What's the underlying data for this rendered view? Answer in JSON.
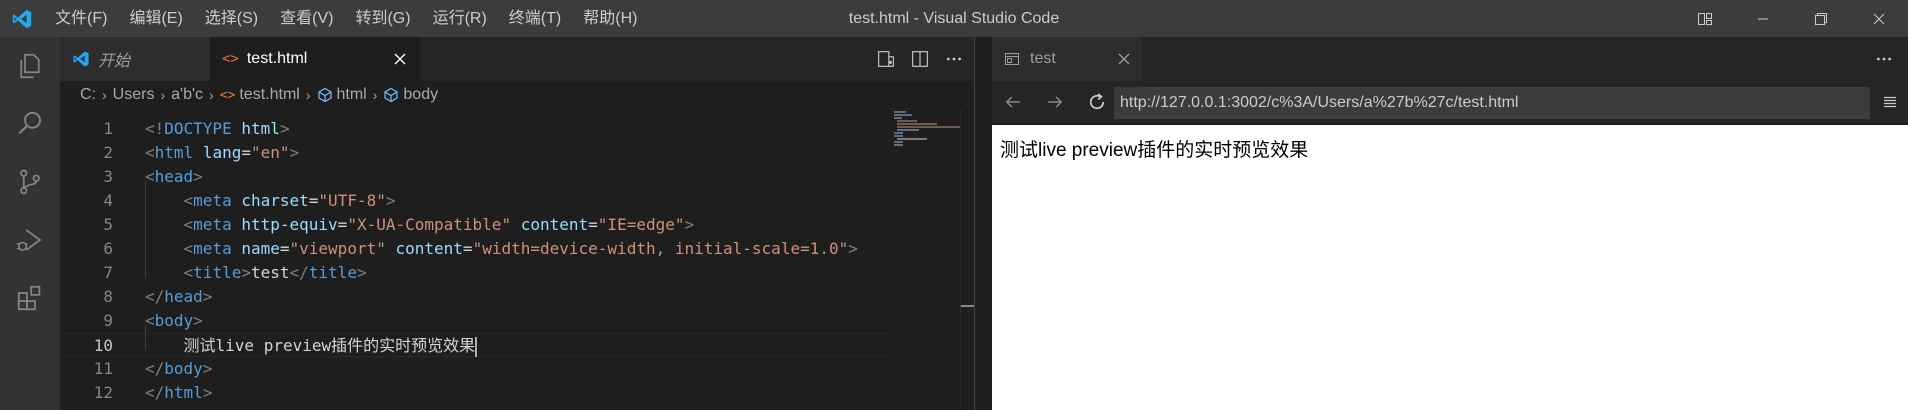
{
  "window": {
    "title": "test.html - Visual Studio Code"
  },
  "menu": [
    "文件(F)",
    "编辑(E)",
    "选择(S)",
    "查看(V)",
    "转到(G)",
    "运行(R)",
    "终端(T)",
    "帮助(H)"
  ],
  "editor": {
    "tabs": [
      {
        "label": "开始",
        "icon": "vscode-logo-icon",
        "active": false
      },
      {
        "label": "test.html",
        "icon": "html-file-icon",
        "active": true
      }
    ],
    "breadcrumb": [
      "C:",
      "Users",
      "a'b'c",
      "test.html",
      "html",
      "body"
    ],
    "lines": [
      {
        "n": "1",
        "tokens": [
          [
            "punc",
            "<!"
          ],
          [
            "tag",
            "DOCTYPE"
          ],
          [
            "text",
            " "
          ],
          [
            "attr",
            "html"
          ],
          [
            "punc",
            ">"
          ]
        ]
      },
      {
        "n": "2",
        "tokens": [
          [
            "punc",
            "<"
          ],
          [
            "tag",
            "html"
          ],
          [
            "text",
            " "
          ],
          [
            "attr",
            "lang"
          ],
          [
            "text",
            "="
          ],
          [
            "str",
            "\"en\""
          ],
          [
            "punc",
            ">"
          ]
        ]
      },
      {
        "n": "3",
        "tokens": [
          [
            "punc",
            "<"
          ],
          [
            "tag",
            "head"
          ],
          [
            "punc",
            ">"
          ]
        ]
      },
      {
        "n": "4",
        "tokens": [
          [
            "text",
            "    "
          ],
          [
            "punc",
            "<"
          ],
          [
            "tag",
            "meta"
          ],
          [
            "text",
            " "
          ],
          [
            "attr",
            "charset"
          ],
          [
            "text",
            "="
          ],
          [
            "str",
            "\"UTF-8\""
          ],
          [
            "punc",
            ">"
          ]
        ]
      },
      {
        "n": "5",
        "tokens": [
          [
            "text",
            "    "
          ],
          [
            "punc",
            "<"
          ],
          [
            "tag",
            "meta"
          ],
          [
            "text",
            " "
          ],
          [
            "attr",
            "http-equiv"
          ],
          [
            "text",
            "="
          ],
          [
            "str",
            "\"X-UA-Compatible\""
          ],
          [
            "text",
            " "
          ],
          [
            "attr",
            "content"
          ],
          [
            "text",
            "="
          ],
          [
            "str",
            "\"IE=edge\""
          ],
          [
            "punc",
            ">"
          ]
        ]
      },
      {
        "n": "6",
        "tokens": [
          [
            "text",
            "    "
          ],
          [
            "punc",
            "<"
          ],
          [
            "tag",
            "meta"
          ],
          [
            "text",
            " "
          ],
          [
            "attr",
            "name"
          ],
          [
            "text",
            "="
          ],
          [
            "str",
            "\"viewport\""
          ],
          [
            "text",
            " "
          ],
          [
            "attr",
            "content"
          ],
          [
            "text",
            "="
          ],
          [
            "str",
            "\"width=device-width, initial-scale=1.0\""
          ],
          [
            "punc",
            ">"
          ]
        ]
      },
      {
        "n": "7",
        "tokens": [
          [
            "text",
            "    "
          ],
          [
            "punc",
            "<"
          ],
          [
            "tag",
            "title"
          ],
          [
            "punc",
            ">"
          ],
          [
            "text",
            "test"
          ],
          [
            "punc",
            "</"
          ],
          [
            "tag",
            "title"
          ],
          [
            "punc",
            ">"
          ]
        ]
      },
      {
        "n": "8",
        "tokens": [
          [
            "punc",
            "</"
          ],
          [
            "tag",
            "head"
          ],
          [
            "punc",
            ">"
          ]
        ]
      },
      {
        "n": "9",
        "tokens": [
          [
            "punc",
            "<"
          ],
          [
            "tag",
            "body"
          ],
          [
            "punc",
            ">"
          ]
        ]
      },
      {
        "n": "10",
        "tokens": [
          [
            "text",
            "    测试live preview插件的实时预览效果"
          ]
        ],
        "current": true
      },
      {
        "n": "11",
        "tokens": [
          [
            "punc",
            "</"
          ],
          [
            "tag",
            "body"
          ],
          [
            "punc",
            ">"
          ]
        ]
      },
      {
        "n": "12",
        "tokens": [
          [
            "punc",
            "</"
          ],
          [
            "tag",
            "html"
          ],
          [
            "punc",
            ">"
          ]
        ]
      }
    ]
  },
  "preview": {
    "tab_label": "test",
    "url": "http://127.0.0.1:3002/c%3A/Users/a%27b%27c/test.html",
    "page_text": "测试live preview插件的实时预览效果"
  },
  "colors": {
    "titlebar": "#3c3c3c",
    "activitybar": "#333333",
    "editor_bg": "#1e1e1e",
    "tag": "#569cd6",
    "attr": "#9cdcfe",
    "string": "#ce9178",
    "vscode_blue": "#23a9f2",
    "html_icon_orange": "#e37933"
  }
}
